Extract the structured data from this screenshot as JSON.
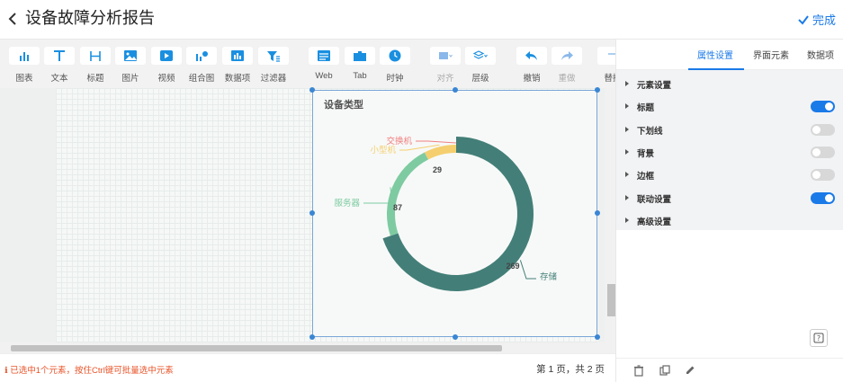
{
  "header": {
    "title": "设备故障分析报告",
    "done_label": "完成"
  },
  "toolbar": {
    "items": [
      {
        "label": "图表",
        "icon": "bar-chart-icon"
      },
      {
        "label": "文本",
        "icon": "text-icon"
      },
      {
        "label": "标题",
        "icon": "heading-icon"
      },
      {
        "label": "图片",
        "icon": "image-icon"
      },
      {
        "label": "视频",
        "icon": "video-icon"
      },
      {
        "label": "组合图",
        "icon": "combo-chart-icon"
      },
      {
        "label": "数据项",
        "icon": "data-item-icon"
      },
      {
        "label": "过滤器",
        "icon": "filter-icon"
      },
      {
        "label": "Web",
        "icon": "web-icon"
      },
      {
        "label": "Tab",
        "icon": "tab-icon"
      },
      {
        "label": "时钟",
        "icon": "clock-icon"
      },
      {
        "label": "对齐",
        "icon": "align-icon"
      },
      {
        "label": "层级",
        "icon": "layers-icon"
      },
      {
        "label": "撤销",
        "icon": "undo-icon"
      },
      {
        "label": "重做",
        "icon": "redo-icon"
      },
      {
        "label": "替换",
        "icon": "replace-icon"
      }
    ]
  },
  "chart_data": {
    "type": "pie",
    "title": "设备类型",
    "categories": [
      "存储",
      "服务器",
      "小型机",
      "交换机"
    ],
    "values": [
      269,
      87,
      29,
      0
    ],
    "colors": [
      "#437f78",
      "#7ecba1",
      "#f5cf6f",
      "#f08080"
    ],
    "data_labels": [
      "269",
      "87",
      "29"
    ]
  },
  "status": {
    "message": "已选中1个元素，按住Ctrl键可批量选中元素",
    "pager": "第 1 页，共 2 页"
  },
  "panel": {
    "tabs": [
      "属性设置",
      "界面元素",
      "数据项"
    ],
    "active_tab": 0,
    "props": [
      {
        "label": "元素设置",
        "toggle": null
      },
      {
        "label": "标题",
        "toggle": true
      },
      {
        "label": "下划线",
        "toggle": false
      },
      {
        "label": "背景",
        "toggle": false
      },
      {
        "label": "边框",
        "toggle": false
      },
      {
        "label": "联动设置",
        "toggle": true
      },
      {
        "label": "高级设置",
        "toggle": null
      }
    ]
  },
  "colors": {
    "accent": "#1a7ae8",
    "warning": "#e8542a"
  }
}
